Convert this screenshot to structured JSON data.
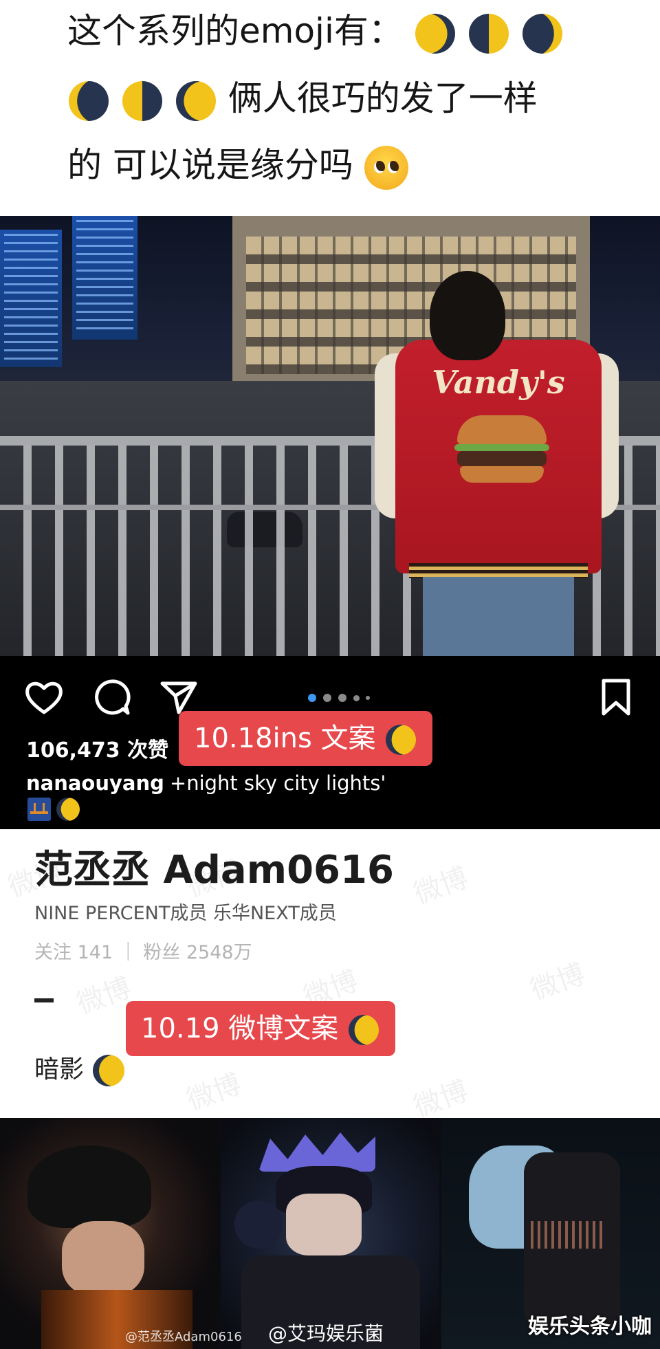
{
  "header": {
    "line1": "这个系列的emoji有：",
    "line2": "俩人很巧的发了一样",
    "line3": "的 可以说是缘分吗",
    "moons_line1": [
      "waxing-gibbous-moon",
      "first-quarter-moon",
      "waxing-crescent-moon"
    ],
    "moons_line2": [
      "waning-crescent-moon",
      "last-quarter-moon",
      "waning-gibbous-moon"
    ],
    "emoji_line3": "pleading-face"
  },
  "photo": {
    "jacket_text": "Vandy's",
    "jacket_colors": {
      "body": "#c21f2c",
      "sleeves": "#e9e1cf"
    }
  },
  "instagram": {
    "likes": "106,473 次赞",
    "username": "nanaouyang",
    "caption": "+night sky city lights'",
    "tag": "10.18ins 文案",
    "pager_dots": 5,
    "icons": [
      "heart-icon",
      "comment-icon",
      "share-icon",
      "bookmark-icon"
    ]
  },
  "weibo": {
    "name": "范丞丞 Adam0616",
    "bio": "NINE PERCENT成员 乐华NEXT成员",
    "stats": "关注 141 ｜ 粉丝 2548万",
    "tag": "10.19 微博文案",
    "post_text": "暗影",
    "watermark": "微博"
  },
  "gallery": {
    "credit1": "@范丞丞Adam0616",
    "credit2": "@艾玛娱乐菌",
    "brand": "娱乐头条小咖"
  },
  "colors": {
    "tag_bg": "#e6484c",
    "ig_bg": "#000000",
    "moon_yellow": "#f2c31b",
    "moon_dark": "#26344f"
  }
}
